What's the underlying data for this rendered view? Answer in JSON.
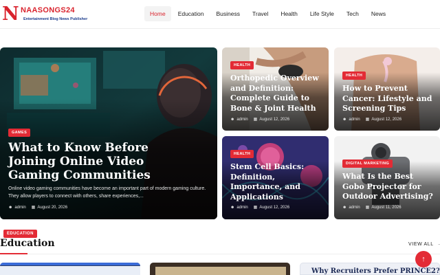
{
  "brand": {
    "logo_letter": "N",
    "name": "NAASONGS24",
    "tagline": "Entertainment Blog News Publisher",
    "accent": "#e32b35"
  },
  "nav": {
    "items": [
      "Home",
      "Education",
      "Business",
      "Travel",
      "Health",
      "Life Style",
      "Tech",
      "News"
    ],
    "active": "Home"
  },
  "featured": {
    "category": "GAMES",
    "title": "What to Know Before Joining Online Video Gaming Communities",
    "excerpt": "Online video gaming communities have become an important part of modern gaming culture. They allow players to connect with others, share experiences,...",
    "author": "admin",
    "date": "August 20, 2026"
  },
  "cards": [
    {
      "category": "HEALTH",
      "title": "Orthopedic Overview and Definition: Complete Guide to Bone & Joint Health",
      "author": "admin",
      "date": "August 12, 2026"
    },
    {
      "category": "HEALTH",
      "title": "How to Prevent Cancer: Lifestyle and Screening Tips",
      "author": "admin",
      "date": "August 12, 2026"
    },
    {
      "category": "HEALTH",
      "title": "Stem Cell Basics: Definition, Importance, and Applications",
      "author": "admin",
      "date": "August 12, 2026"
    },
    {
      "category": "DIGITAL MARKETING",
      "title": "What Is the Best Gobo Projector for Outdoor Advertising?",
      "author": "admin",
      "date": "August 11, 2026"
    }
  ],
  "section": {
    "badge": "EDUCATION",
    "title": "Education",
    "view_all": "VIEW ALL"
  },
  "bottom_thumbs": {
    "third_title": "Why Recruiters Prefer PRINCE2?"
  },
  "icons": {
    "user": "user-icon",
    "calendar": "calendar-icon",
    "arrow_right": "arrow-right-icon",
    "back_to_top": "arrow-up-icon"
  }
}
